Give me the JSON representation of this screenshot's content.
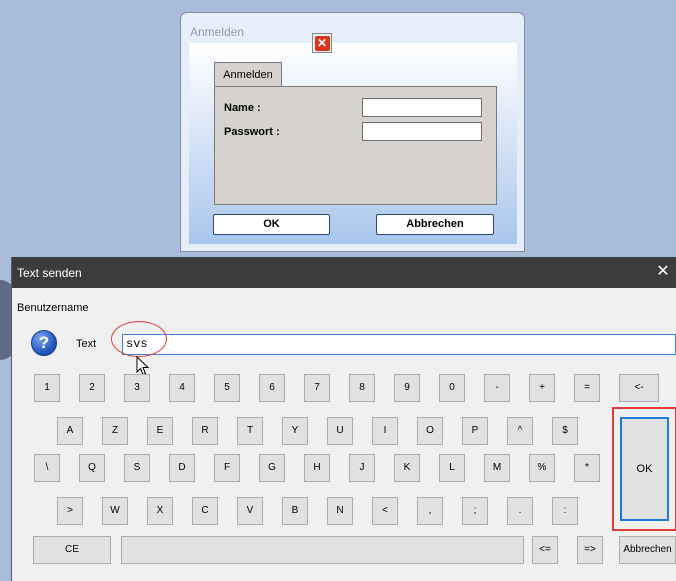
{
  "login_dialog": {
    "title": "Anmelden",
    "tab": "Anmelden",
    "name_label": "Name :",
    "password_label": "Passwort :",
    "ok_label": "OK",
    "cancel_label": "Abbrechen",
    "close_icon": "close-x-red-icon"
  },
  "keyboard": {
    "title": "Text senden",
    "close_glyph": "✕",
    "caption": "Benutzername",
    "text_label": "Text",
    "text_value": "svs",
    "help_icon": "question-icon",
    "row1": [
      "1",
      "2",
      "3",
      "4",
      "5",
      "6",
      "7",
      "8",
      "9",
      "0",
      "-",
      "+",
      "=",
      "<-"
    ],
    "row2": [
      "A",
      "Z",
      "E",
      "R",
      "T",
      "Y",
      "U",
      "I",
      "O",
      "P",
      "^",
      "$"
    ],
    "row3": [
      "\\",
      "Q",
      "S",
      "D",
      "F",
      "G",
      "H",
      "J",
      "K",
      "L",
      "M",
      "%",
      "*"
    ],
    "row4": [
      ">",
      "W",
      "X",
      "C",
      "V",
      "B",
      "N",
      "<",
      ",",
      ";",
      ".",
      ":"
    ],
    "ce_label": "CE",
    "left_label": "<=",
    "right_label": "=>",
    "ok_label": "OK",
    "abbrechen_label": "Abbrechen",
    "annotation_color": "#e03c3c",
    "focus_color": "#1e7bd8"
  }
}
